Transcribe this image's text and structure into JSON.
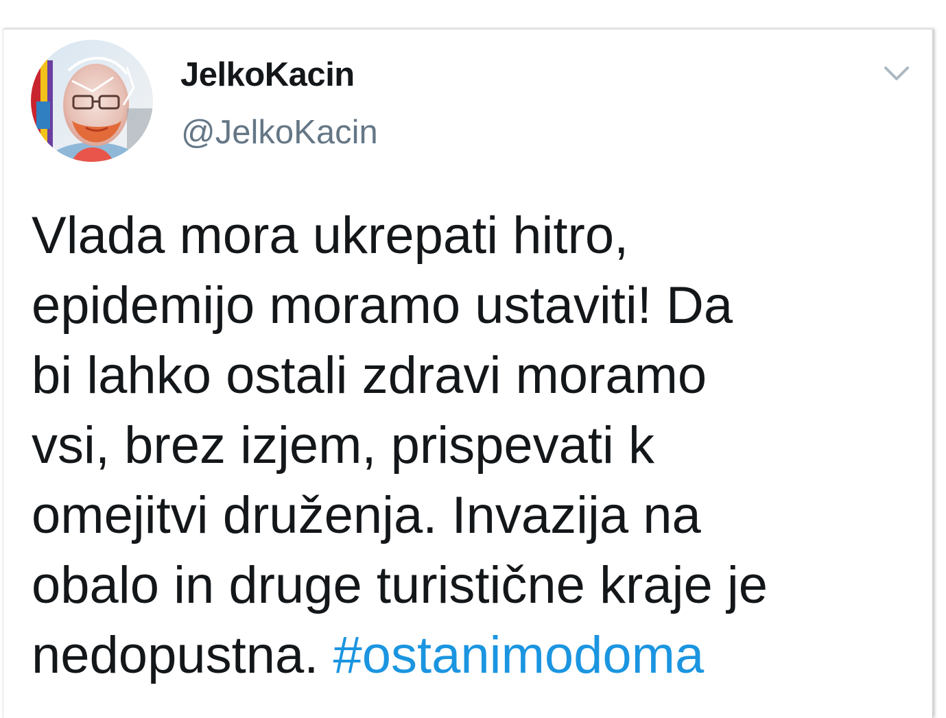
{
  "tweet": {
    "author": {
      "display_name": "JelkoKacin",
      "handle": "@JelkoKacin"
    },
    "menu_icon": "chevron-down-icon",
    "text_lines": [
      "Vlada mora ukrepati hitro,",
      "epidemijo moramo ustaviti! Da",
      "bi lahko ostali zdravi moramo",
      "vsi, brez izjem, prispevati k",
      "omejitvi druženja. Invazija na",
      "obalo in druge turistične kraje je",
      "nedopustna. "
    ],
    "hashtag": "#ostanimodoma"
  },
  "colors": {
    "text": "#14171a",
    "handle": "#657786",
    "hashtag": "#1b95e0",
    "caret": "#aab8c2"
  }
}
